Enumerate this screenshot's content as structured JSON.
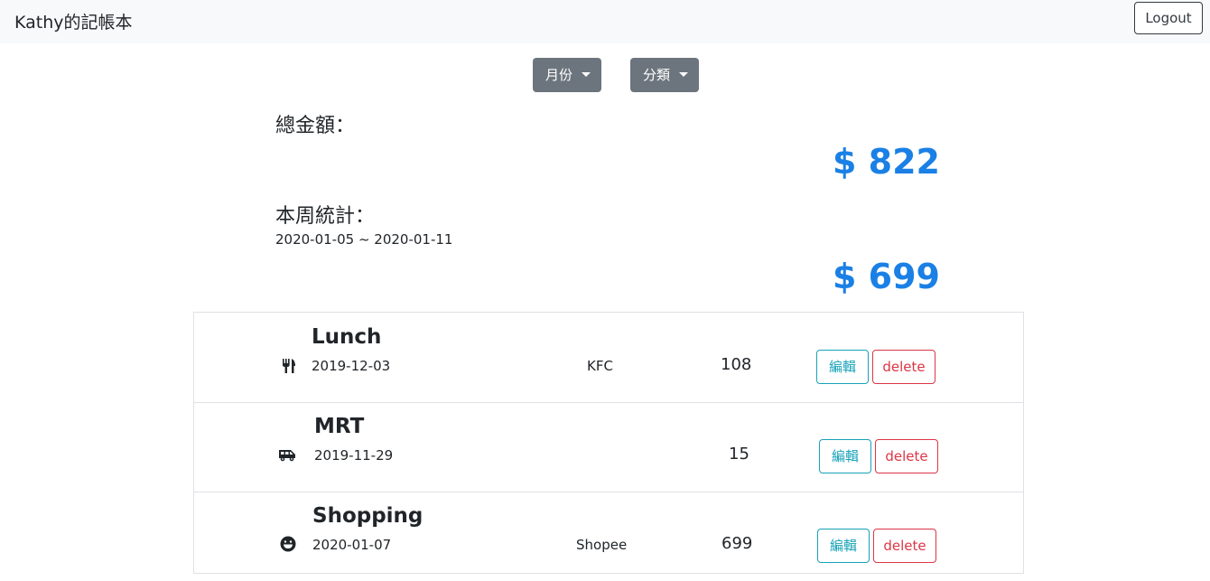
{
  "navbar": {
    "brand": "Kathy的記帳本",
    "logout_label": "Logout"
  },
  "filters": {
    "month_label": "月份",
    "category_label": "分類"
  },
  "summary": {
    "total_label": "總金額：",
    "total_amount": "$ 822",
    "week_label": "本周統計：",
    "week_range": "2020-01-05 ~ 2020-01-11",
    "week_amount": "$ 699"
  },
  "records": [
    {
      "name": "Lunch",
      "date": "2019-12-03",
      "merchant": "KFC",
      "amount": "108",
      "icon": "utensils-icon",
      "edit_label": "編輯",
      "delete_label": "delete"
    },
    {
      "name": "MRT",
      "date": "2019-11-29",
      "merchant": "",
      "amount": "15",
      "icon": "shuttle-van-icon",
      "edit_label": "編輯",
      "delete_label": "delete"
    },
    {
      "name": "Shopping",
      "date": "2020-01-07",
      "merchant": "Shopee",
      "amount": "699",
      "icon": "grin-icon",
      "edit_label": "編輯",
      "delete_label": "delete"
    }
  ],
  "colors": {
    "accent": "#1a80e5",
    "edit": "#17a2b8",
    "delete": "#dc3545",
    "dropdown": "#6c757d"
  }
}
